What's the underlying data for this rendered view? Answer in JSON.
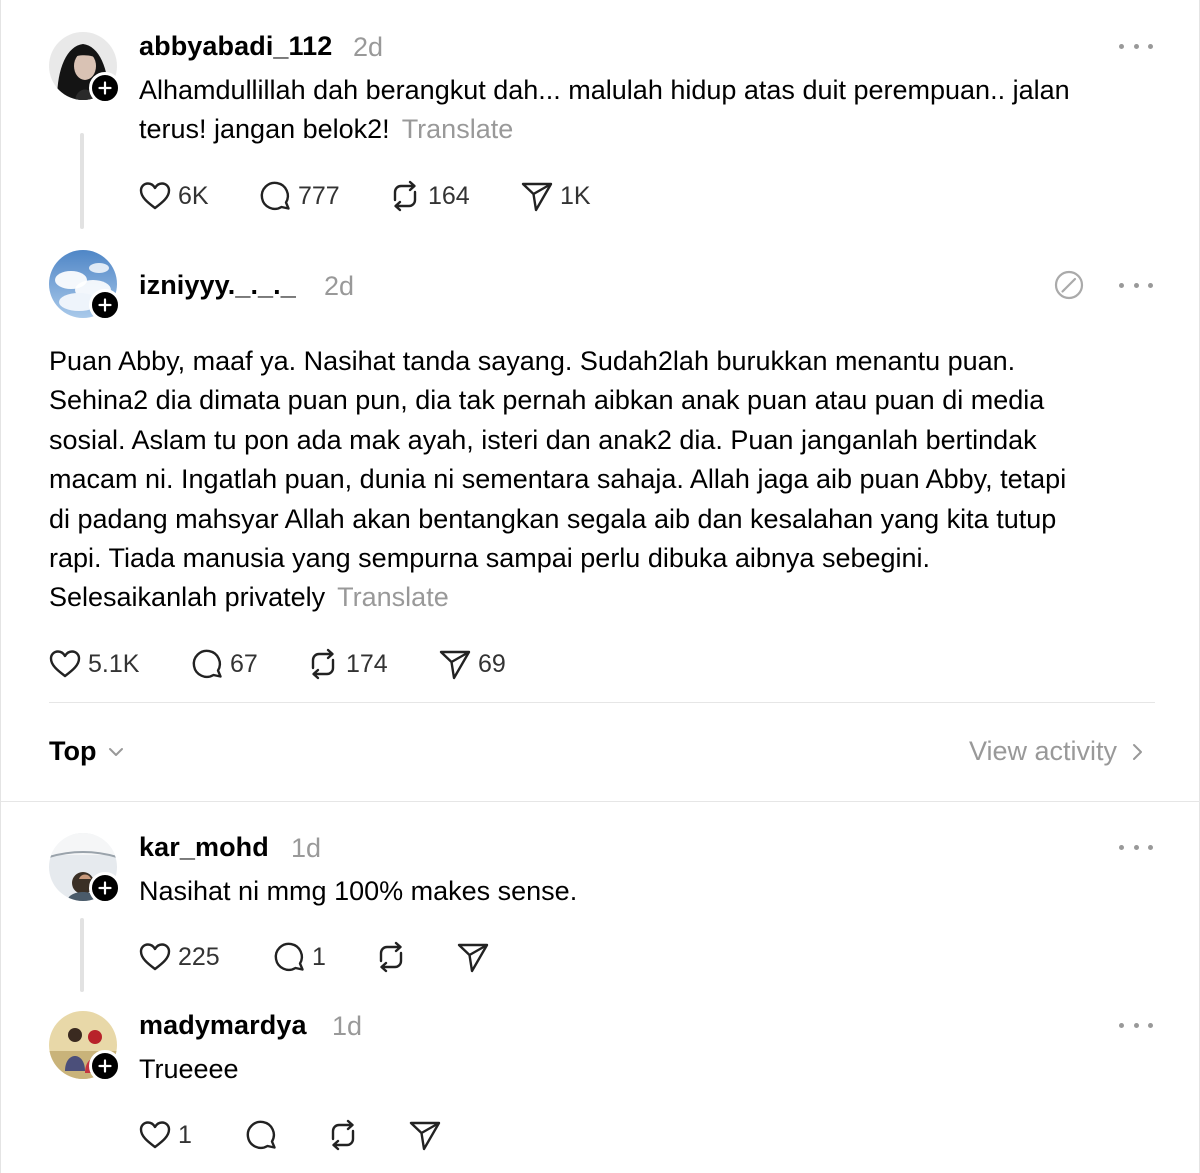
{
  "posts": [
    {
      "username": "abbyabadi_112",
      "time": "2d",
      "text": "Alhamdullillah dah berangkut dah... malulah hidup atas duit perempuan.. jalan terus! jangan belok2!",
      "text_lines": [
        "Alhamdullillah dah berangkut dah... malulah hidup atas duit perempuan.. jalan",
        "terus! jangan belok2!"
      ],
      "translate": "Translate",
      "likes": "6K",
      "comments": "777",
      "reposts": "164",
      "shares": "1K"
    },
    {
      "username": "izniyyy._._._",
      "time": "2d",
      "text_lines": [
        "Puan Abby, maaf ya. Nasihat tanda sayang. Sudah2lah burukkan menantu puan.",
        "Sehina2 dia dimata puan pun, dia tak pernah aibkan anak puan atau puan di media",
        "sosial. Aslam tu pon ada mak ayah, isteri dan anak2 dia. Puan janganlah bertindak",
        "macam ni. Ingatlah puan, dunia ni sementara sahaja. Allah jaga aib puan Abby, tetapi",
        "di padang mahsyar Allah akan bentangkan segala aib dan kesalahan yang kita tutup",
        "rapi. Tiada manusia yang sempurna sampai perlu dibuka aibnya sebegini.",
        "Selesaikanlah privately"
      ],
      "translate": "Translate",
      "likes": "5.1K",
      "comments": "67",
      "reposts": "174",
      "shares": "69"
    }
  ],
  "sort": {
    "label": "Top",
    "view_activity": "View activity"
  },
  "replies": [
    {
      "username": "kar_mohd",
      "time": "1d",
      "text": "Nasihat ni mmg 100% makes sense.",
      "likes": "225",
      "comments": "1"
    },
    {
      "username": "madymardya",
      "time": "1d",
      "text": "Trueeee",
      "likes": "1"
    }
  ],
  "icons": [
    "heart-icon",
    "comment-icon",
    "repost-icon",
    "share-icon",
    "more-icon",
    "follow-plus-icon",
    "chevron-down-icon",
    "chevron-right-icon",
    "edit-icon"
  ]
}
